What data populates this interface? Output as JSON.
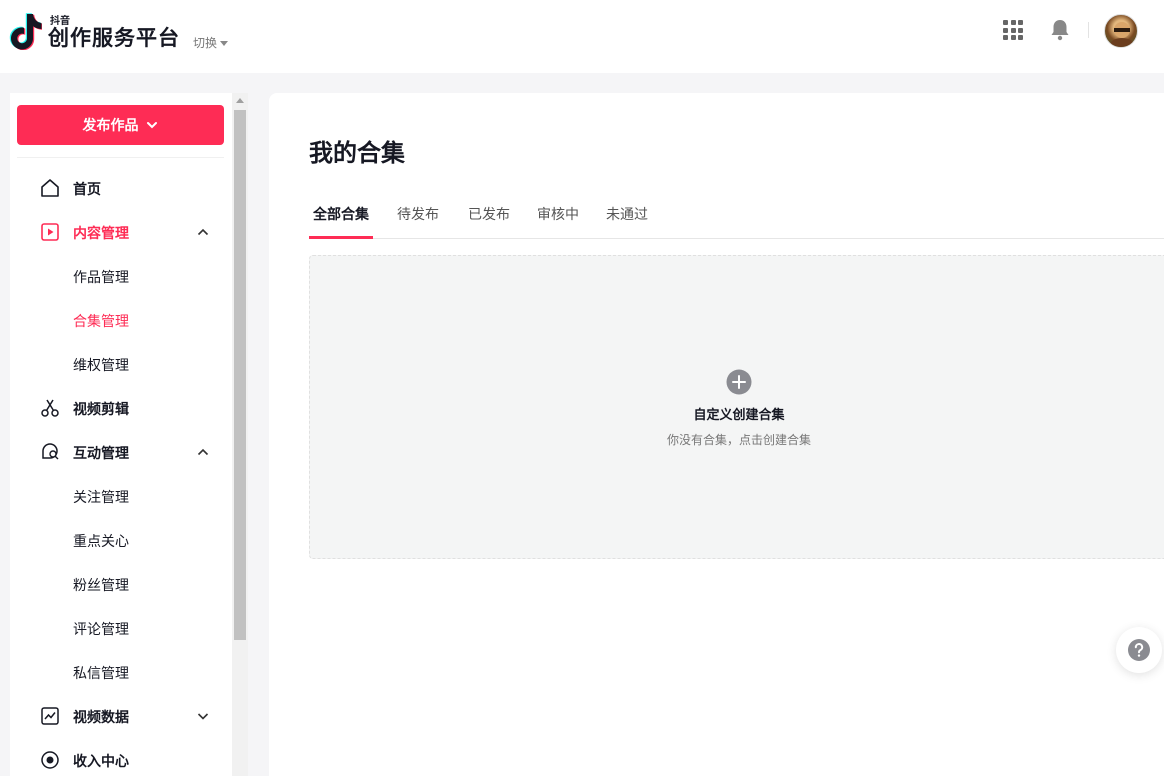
{
  "header": {
    "brand_small": "抖音",
    "brand_main": "创作服务平台",
    "switch_label": "切换",
    "icons": {
      "apps": "grid-apps-icon",
      "notifications": "bell-icon",
      "avatar": "user-avatar"
    }
  },
  "sidebar": {
    "publish_label": "发布作品",
    "nav": [
      {
        "label": "首页",
        "icon": "home-icon"
      },
      {
        "label": "内容管理",
        "icon": "play-square-icon",
        "expanded": true,
        "active": true,
        "children": [
          {
            "label": "作品管理"
          },
          {
            "label": "合集管理",
            "active": true
          },
          {
            "label": "维权管理"
          }
        ]
      },
      {
        "label": "视频剪辑",
        "icon": "scissors-icon"
      },
      {
        "label": "互动管理",
        "icon": "chat-search-icon",
        "expanded": true,
        "children": [
          {
            "label": "关注管理"
          },
          {
            "label": "重点关心"
          },
          {
            "label": "粉丝管理"
          },
          {
            "label": "评论管理"
          },
          {
            "label": "私信管理"
          }
        ]
      },
      {
        "label": "视频数据",
        "icon": "trend-chart-icon",
        "expanded": false
      },
      {
        "label": "收入中心",
        "icon": "income-circle-icon"
      }
    ]
  },
  "main": {
    "title": "我的合集",
    "tabs": [
      {
        "label": "全部合集",
        "active": true
      },
      {
        "label": "待发布"
      },
      {
        "label": "已发布"
      },
      {
        "label": "审核中"
      },
      {
        "label": "未通过"
      }
    ],
    "empty": {
      "title": "自定义创建合集",
      "subtitle": "你没有合集，点击创建合集"
    }
  },
  "colors": {
    "accent": "#fe2c55",
    "text": "#161823",
    "page_bg": "#f5f5f7"
  }
}
